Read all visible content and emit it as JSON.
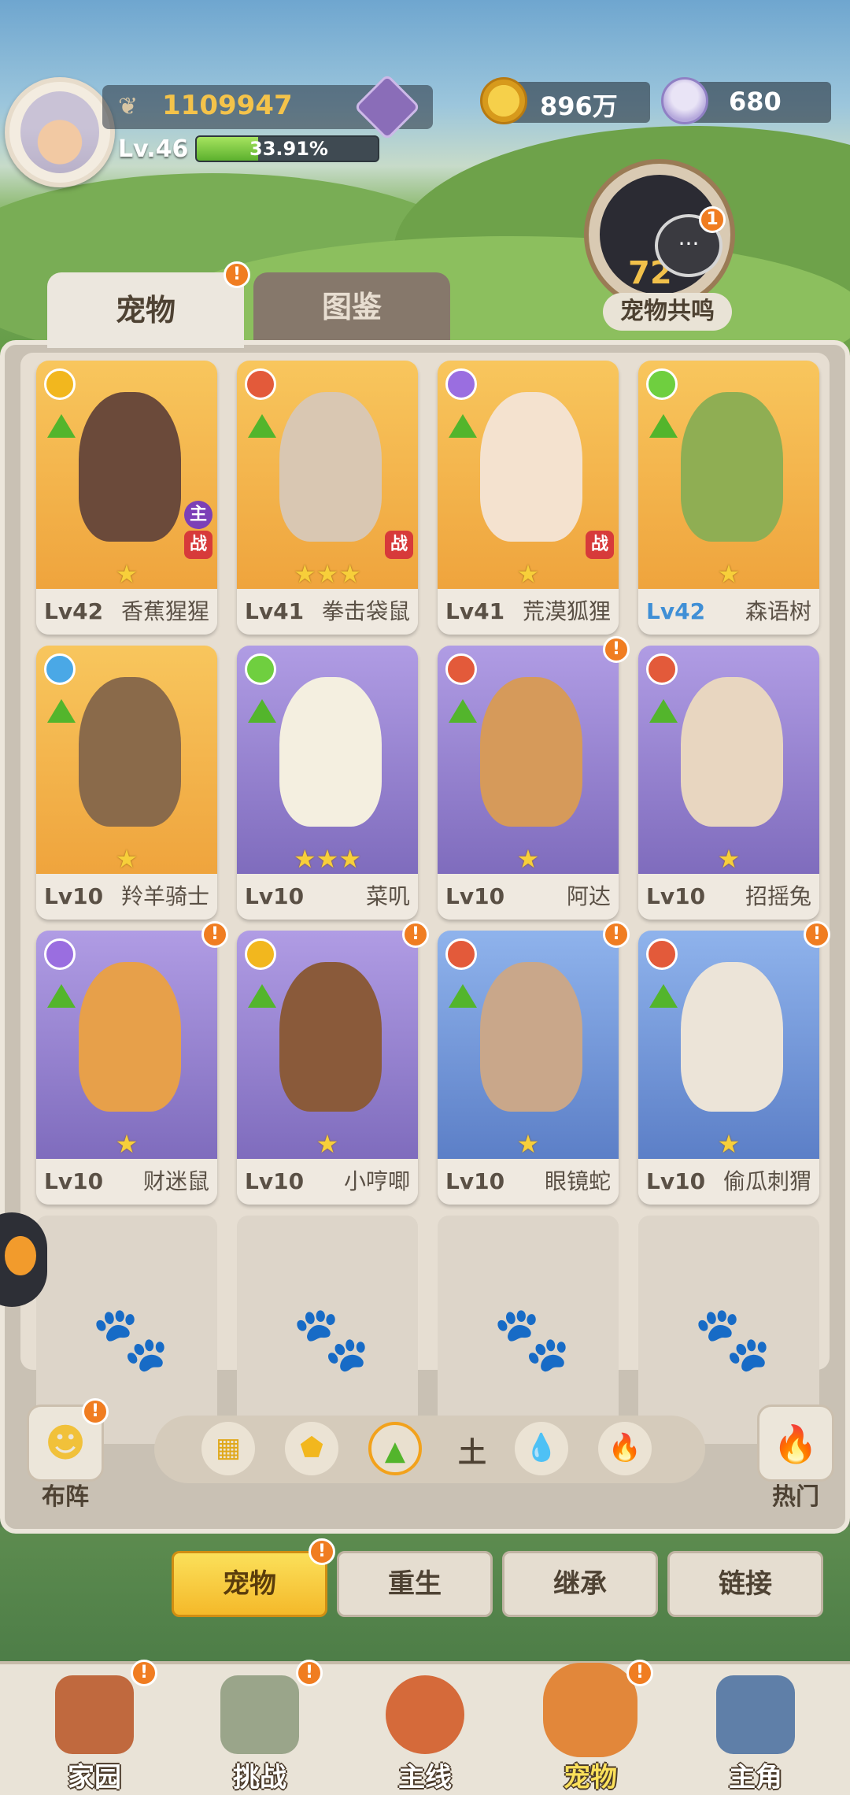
{
  "header": {
    "power": "1109947",
    "level": "Lv.46",
    "xp_percent": "33.91%",
    "xp_fraction": 0.3391,
    "coins": "896万",
    "shells": "680",
    "resonance_label": "宠物共鸣",
    "resonance_value": "72",
    "resonance_badge": "1"
  },
  "tabs": [
    {
      "label": "宠物"
    },
    {
      "label": "图鉴"
    }
  ],
  "pets": [
    {
      "level": "Lv42",
      "name": "香蕉猩猩",
      "element": "盾",
      "stars": "★",
      "tags": [
        "主",
        "战"
      ]
    },
    {
      "level": "Lv41",
      "name": "拳击袋鼠",
      "element": "斧",
      "stars": "★★★",
      "tags": [
        "战"
      ]
    },
    {
      "level": "Lv41",
      "name": "荒漠狐狸",
      "element": "魂",
      "stars": "★",
      "tags": [
        "战"
      ]
    },
    {
      "level": "Lv42",
      "name": "森语树",
      "element": "心",
      "stars": "★",
      "tags": []
    },
    {
      "level": "Lv10",
      "name": "羚羊骑士",
      "element": "杖",
      "stars": "★",
      "tags": []
    },
    {
      "level": "Lv10",
      "name": "菜叽",
      "element": "心",
      "stars": "★★★",
      "tags": []
    },
    {
      "level": "Lv10",
      "name": "阿达",
      "element": "斧",
      "stars": "★",
      "tags": []
    },
    {
      "level": "Lv10",
      "name": "招摇兔",
      "element": "斧",
      "stars": "★",
      "tags": []
    },
    {
      "level": "Lv10",
      "name": "财迷鼠",
      "element": "魂",
      "stars": "★",
      "tags": []
    },
    {
      "level": "Lv10",
      "name": "小哼唧",
      "element": "盾",
      "stars": "★",
      "tags": []
    },
    {
      "level": "Lv10",
      "name": "眼镜蛇",
      "element": "斧",
      "stars": "★",
      "tags": []
    },
    {
      "level": "Lv10",
      "name": "偷瓜刺猬",
      "element": "斧",
      "stars": "★",
      "tags": []
    }
  ],
  "filter": {
    "formation_label": "布阵",
    "hot_label": "热门",
    "selected_text": "土",
    "icons": [
      "grid-icon",
      "shield-icon",
      "earth-icon",
      "water-icon",
      "fire-icon"
    ]
  },
  "subtabs": [
    "宠物",
    "重生",
    "继承",
    "链接"
  ],
  "nav": [
    "家园",
    "挑战",
    "主线",
    "宠物",
    "主角"
  ],
  "colors": {
    "accent": "#f4b92a",
    "badge": "#f07d21",
    "earth": "#53b52c"
  }
}
